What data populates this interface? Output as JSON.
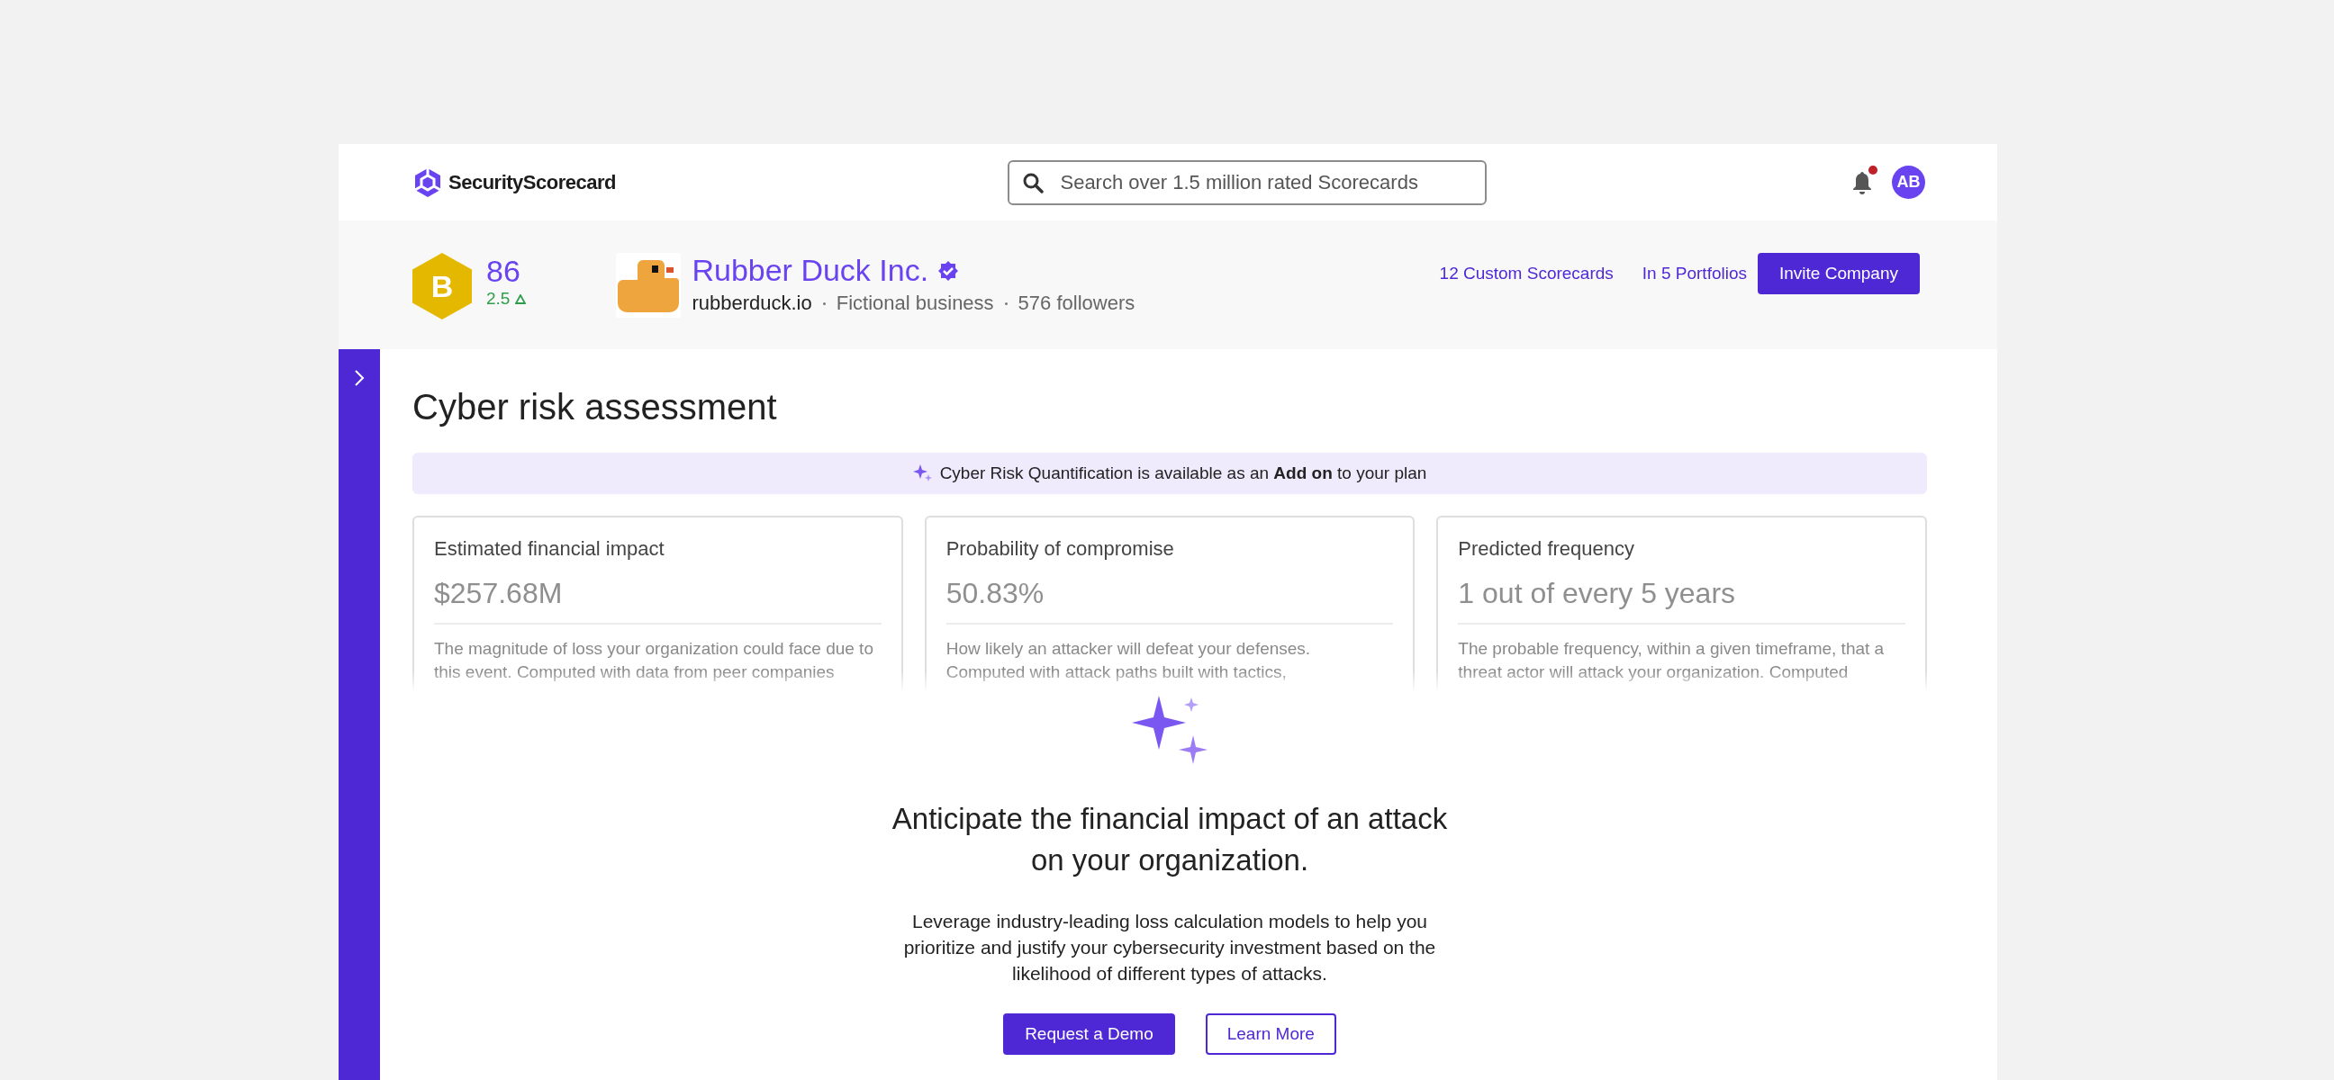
{
  "header": {
    "logo": "SecurityScorecard",
    "search": {
      "placeholder": "Search over 1.5 million rated Scorecards"
    },
    "notifications": {
      "unread": true
    },
    "avatar": "AB"
  },
  "company": {
    "grade": "B",
    "score": "86",
    "change": "2.5",
    "name": "Rubber Duck Inc.",
    "verified": true,
    "domain": "rubberduck.io",
    "industry": "Fictional business",
    "followers": "576 followers",
    "links": [
      "12 Custom Scorecards",
      "In 5 Portfolios"
    ],
    "invite_button": "Invite Company"
  },
  "sidebar": {
    "expanded": false
  },
  "page": {
    "title": "Cyber risk assessment",
    "banner": "Cyber Risk Quantification is available as an **Add on** to your plan",
    "cards": [
      {
        "label": "Estimated financial impact",
        "value": "$257.68M",
        "description": "The magnitude of loss your organization could face due to this event. Computed with data from peer companies"
      },
      {
        "label": "Probability of compromise",
        "value": "50.83%",
        "description": "How likely an attacker will defeat your defenses. Computed with attack paths built with tactics,"
      },
      {
        "label": "Predicted frequency",
        "value": "1 out of every 5 years",
        "description": "The probable frequency, within a given timeframe, that a threat actor will attack your organization. Computed"
      }
    ],
    "promo": {
      "heading": "Anticipate the financial impact of an attack on your organization.",
      "body": "Leverage industry-leading loss calculation models to help you prioritize and justify your cybersecurity investment based on the likelihood of different types of attacks.",
      "buttons": [
        {
          "label": "Request a Demo",
          "kind": "primary"
        },
        {
          "label": "Learn More",
          "kind": "secondary"
        }
      ]
    }
  }
}
